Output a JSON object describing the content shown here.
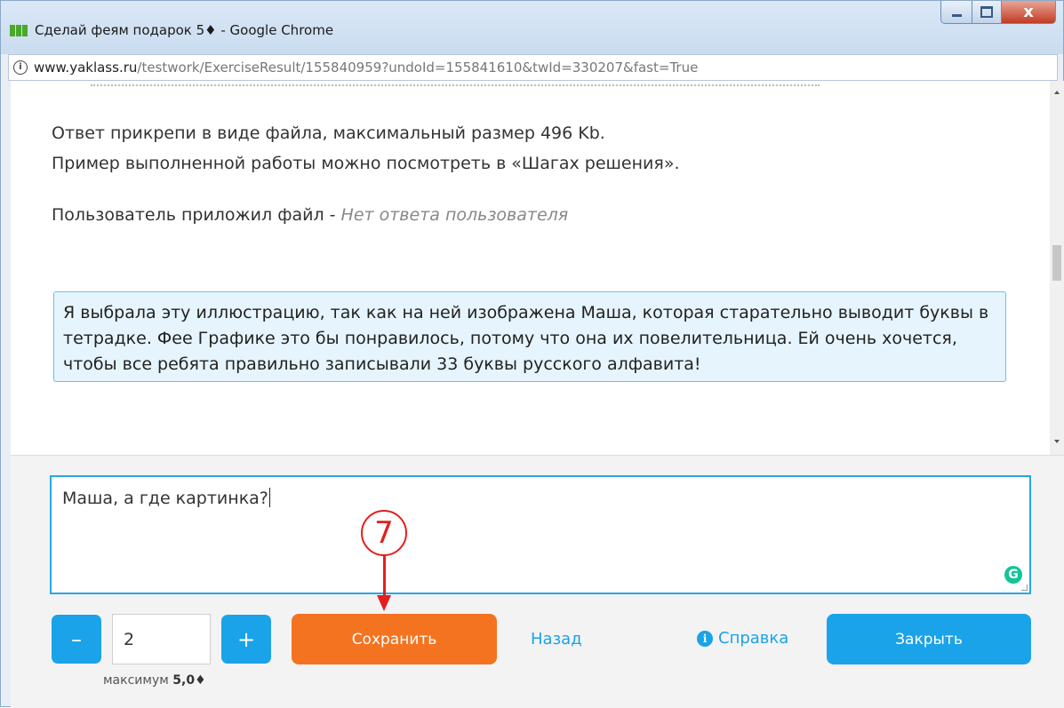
{
  "window": {
    "title": "Сделай феям подарок 5♦ - Google Chrome",
    "url_host": "www.yaklass.ru",
    "url_rest": "/testwork/ExerciseResult/155840959?undoId=155841610&twId=330207&fast=True",
    "close_glyph": "x"
  },
  "content": {
    "line1": "Ответ прикрепи в виде файла, максимальный размер 496 Kb.",
    "line2": "Пример выполненной работы можно посмотреть в «Шагах решения».",
    "user_file_label": "Пользователь приложил файл - ",
    "user_file_value": "Нет ответа пользователя",
    "answer_text": "Я выбрала эту иллюстрацию, так как на ней изображена Маша, которая старательно выводит буквы в тетрадке. Фее Графике это бы понравилось, потому что она их повелительница. Ей очень хочется, чтобы все ребята правильно записывали 33 буквы русского алфавита!"
  },
  "comment": {
    "value": "Маша, а где картинка?",
    "grammarly_glyph": "G"
  },
  "score": {
    "minus_label": "–",
    "plus_label": "+",
    "value": "2",
    "max_prefix": "максимум ",
    "max_value": "5,0♦"
  },
  "buttons": {
    "save": "Сохранить",
    "back": "Назад",
    "help": "Справка",
    "help_glyph": "i",
    "close": "Закрыть"
  },
  "annotation": {
    "number": "7"
  },
  "colors": {
    "accent_blue": "#1aa3e8",
    "save_orange": "#f47321",
    "annotation_red": "#e41e1e"
  }
}
